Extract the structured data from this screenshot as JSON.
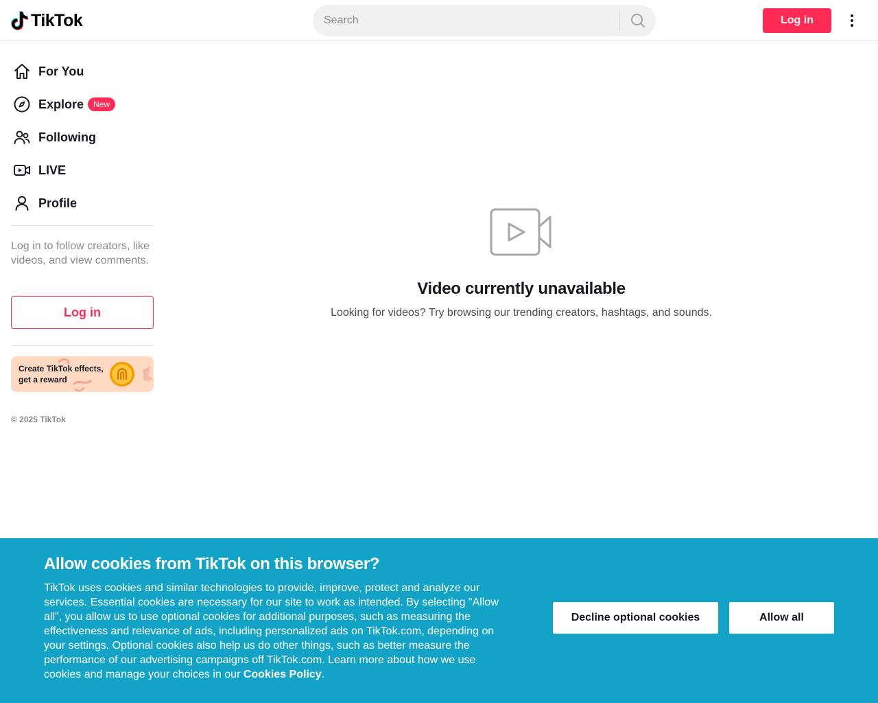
{
  "header": {
    "logo_text": "TikTok",
    "search_placeholder": "Search",
    "login_label": "Log in"
  },
  "sidebar": {
    "items": [
      {
        "label": "For You",
        "icon": "home-icon"
      },
      {
        "label": "Explore",
        "icon": "compass-icon",
        "badge": "New"
      },
      {
        "label": "Following",
        "icon": "people-icon"
      },
      {
        "label": "LIVE",
        "icon": "live-icon"
      },
      {
        "label": "Profile",
        "icon": "person-icon"
      }
    ],
    "login_hint": "Log in to follow creators, like videos, and view comments.",
    "login_label": "Log in",
    "effects_banner": "Create TikTok effects, get a reward",
    "copyright": "© 2025 TikTok"
  },
  "main": {
    "title": "Video currently unavailable",
    "subtitle": "Looking for videos? Try browsing our trending creators, hashtags, and sounds."
  },
  "cookie": {
    "title": "Allow cookies from TikTok on this browser?",
    "body": "TikTok uses cookies and similar technologies to provide, improve, protect and analyze our services. Essential cookies are necessary for our site to work as intended. By selecting \"Allow all\", you allow us to use optional cookies for additional purposes, such as measuring the effectiveness and relevance of ads, including personalized ads on TikTok.com, depending on your settings. Optional cookies also help us do other things, such as better measure the performance of our advertising campaigns off TikTok.com. Learn more about how we use cookies and manage your choices in our ",
    "link_text": "Cookies Policy",
    "end_punct": ".",
    "decline_label": "Decline optional cookies",
    "allow_label": "Allow all"
  },
  "colors": {
    "brand": "#fe2c55",
    "cookie_bg": "#12a3c6",
    "text": "#161823",
    "muted": "#8a8b91"
  }
}
